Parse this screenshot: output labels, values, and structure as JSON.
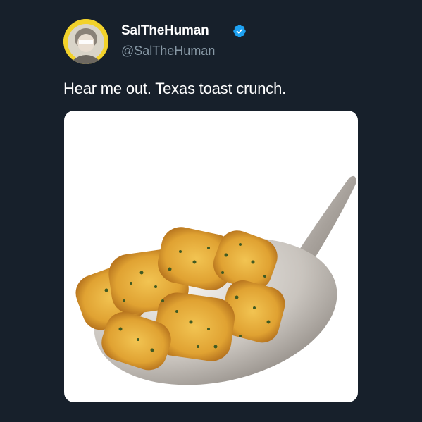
{
  "user": {
    "display_name": "SalTheHuman",
    "handle": "@SalTheHuman",
    "verified": true
  },
  "tweet": {
    "text": "Hear me out. Texas toast crunch."
  },
  "colors": {
    "background": "#17202b",
    "text_primary": "#ffffff",
    "text_secondary": "#8899a6",
    "verified_badge": "#1da1f2",
    "avatar_ring": "#f2d22b"
  },
  "icons": {
    "verified": "verified-badge-icon"
  }
}
